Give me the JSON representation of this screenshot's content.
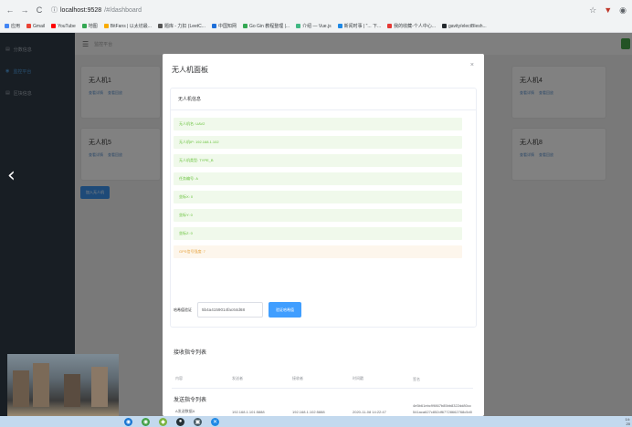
{
  "browser": {
    "url_host": "localhost:9528",
    "url_path": "/#/dashboard",
    "nav_back": "←",
    "nav_forward": "→",
    "nav_reload": "C",
    "bookmarks": [
      {
        "label": "应用",
        "color": "#4285f4"
      },
      {
        "label": "Gmail",
        "color": "#ea4335"
      },
      {
        "label": "YouTube",
        "color": "#ff0000"
      },
      {
        "label": "地图",
        "color": "#34a853"
      },
      {
        "label": "BitFans | 以太坊最...",
        "color": "#f9ab00"
      },
      {
        "label": "题库 - 力扣 (LeetC...",
        "color": "#555555"
      },
      {
        "label": "中国知网",
        "color": "#1e6fd9"
      },
      {
        "label": "Go Gin 教程整理 |...",
        "color": "#34a853"
      },
      {
        "label": "介绍 — Vue.js",
        "color": "#41b883"
      },
      {
        "label": "新闻时事 | \"... 下...",
        "color": "#1e88e5"
      },
      {
        "label": "我的收藏-个人中心...",
        "color": "#e53935"
      },
      {
        "label": "gavity/electBlesh...",
        "color": "#24292e"
      }
    ]
  },
  "app": {
    "sidebar": [
      {
        "label": "分数信息"
      },
      {
        "label": "监控平台"
      },
      {
        "label": "区块信息"
      }
    ],
    "topbar_title": "监控平台",
    "cards": [
      {
        "title": "无人机1",
        "link1": "查看详情",
        "link2": "查看回放"
      },
      {
        "title": "无人机4",
        "link1": "查看详情",
        "link2": "查看回放"
      },
      {
        "title": "无人机5",
        "link1": "查看详情",
        "link2": "查看回放"
      },
      {
        "title": "无人机8",
        "link1": "查看详情",
        "link2": "查看回放"
      }
    ],
    "add_button": "加入无人机"
  },
  "modal": {
    "title": "无人机面板",
    "close": "×",
    "info_header": "无人机信息",
    "info_items": [
      {
        "text": "无人机名: UAV2",
        "status": "success"
      },
      {
        "text": "无人机IP: 192.168.1.102",
        "status": "success"
      },
      {
        "text": "无人机类型: TYPE_B",
        "status": "success"
      },
      {
        "text": "任务编号: A",
        "status": "success"
      },
      {
        "text": "坐标X: 0",
        "status": "success"
      },
      {
        "text": "坐标Y: 0",
        "status": "success"
      },
      {
        "text": "坐标Z: 0",
        "status": "success"
      },
      {
        "text": "GPS信号强度: 7",
        "status": "warning"
      }
    ],
    "verify_label": "哈希值验证",
    "verify_value": "5b4a4159014fac64d68",
    "verify_button": "验证哈希值",
    "received_title": "接收指令列表",
    "table_headers": [
      "内容",
      "发送者",
      "接收者",
      "时间戳",
      "签名"
    ],
    "table_rows": [
      {
        "content": "A发送数据A",
        "sender": "192.168.1.101:5888",
        "receiver": "192.168.1.102:5888",
        "timestamp": "2020-11-08 14:22:47",
        "signature": "4e5b61ebc99867b85bb8322dd80cc541aca627c852df67728662768c5d034bd5"
      }
    ],
    "sent_title": "发送指令列表"
  },
  "tray": {
    "line1": "14:",
    "line2": "20"
  }
}
